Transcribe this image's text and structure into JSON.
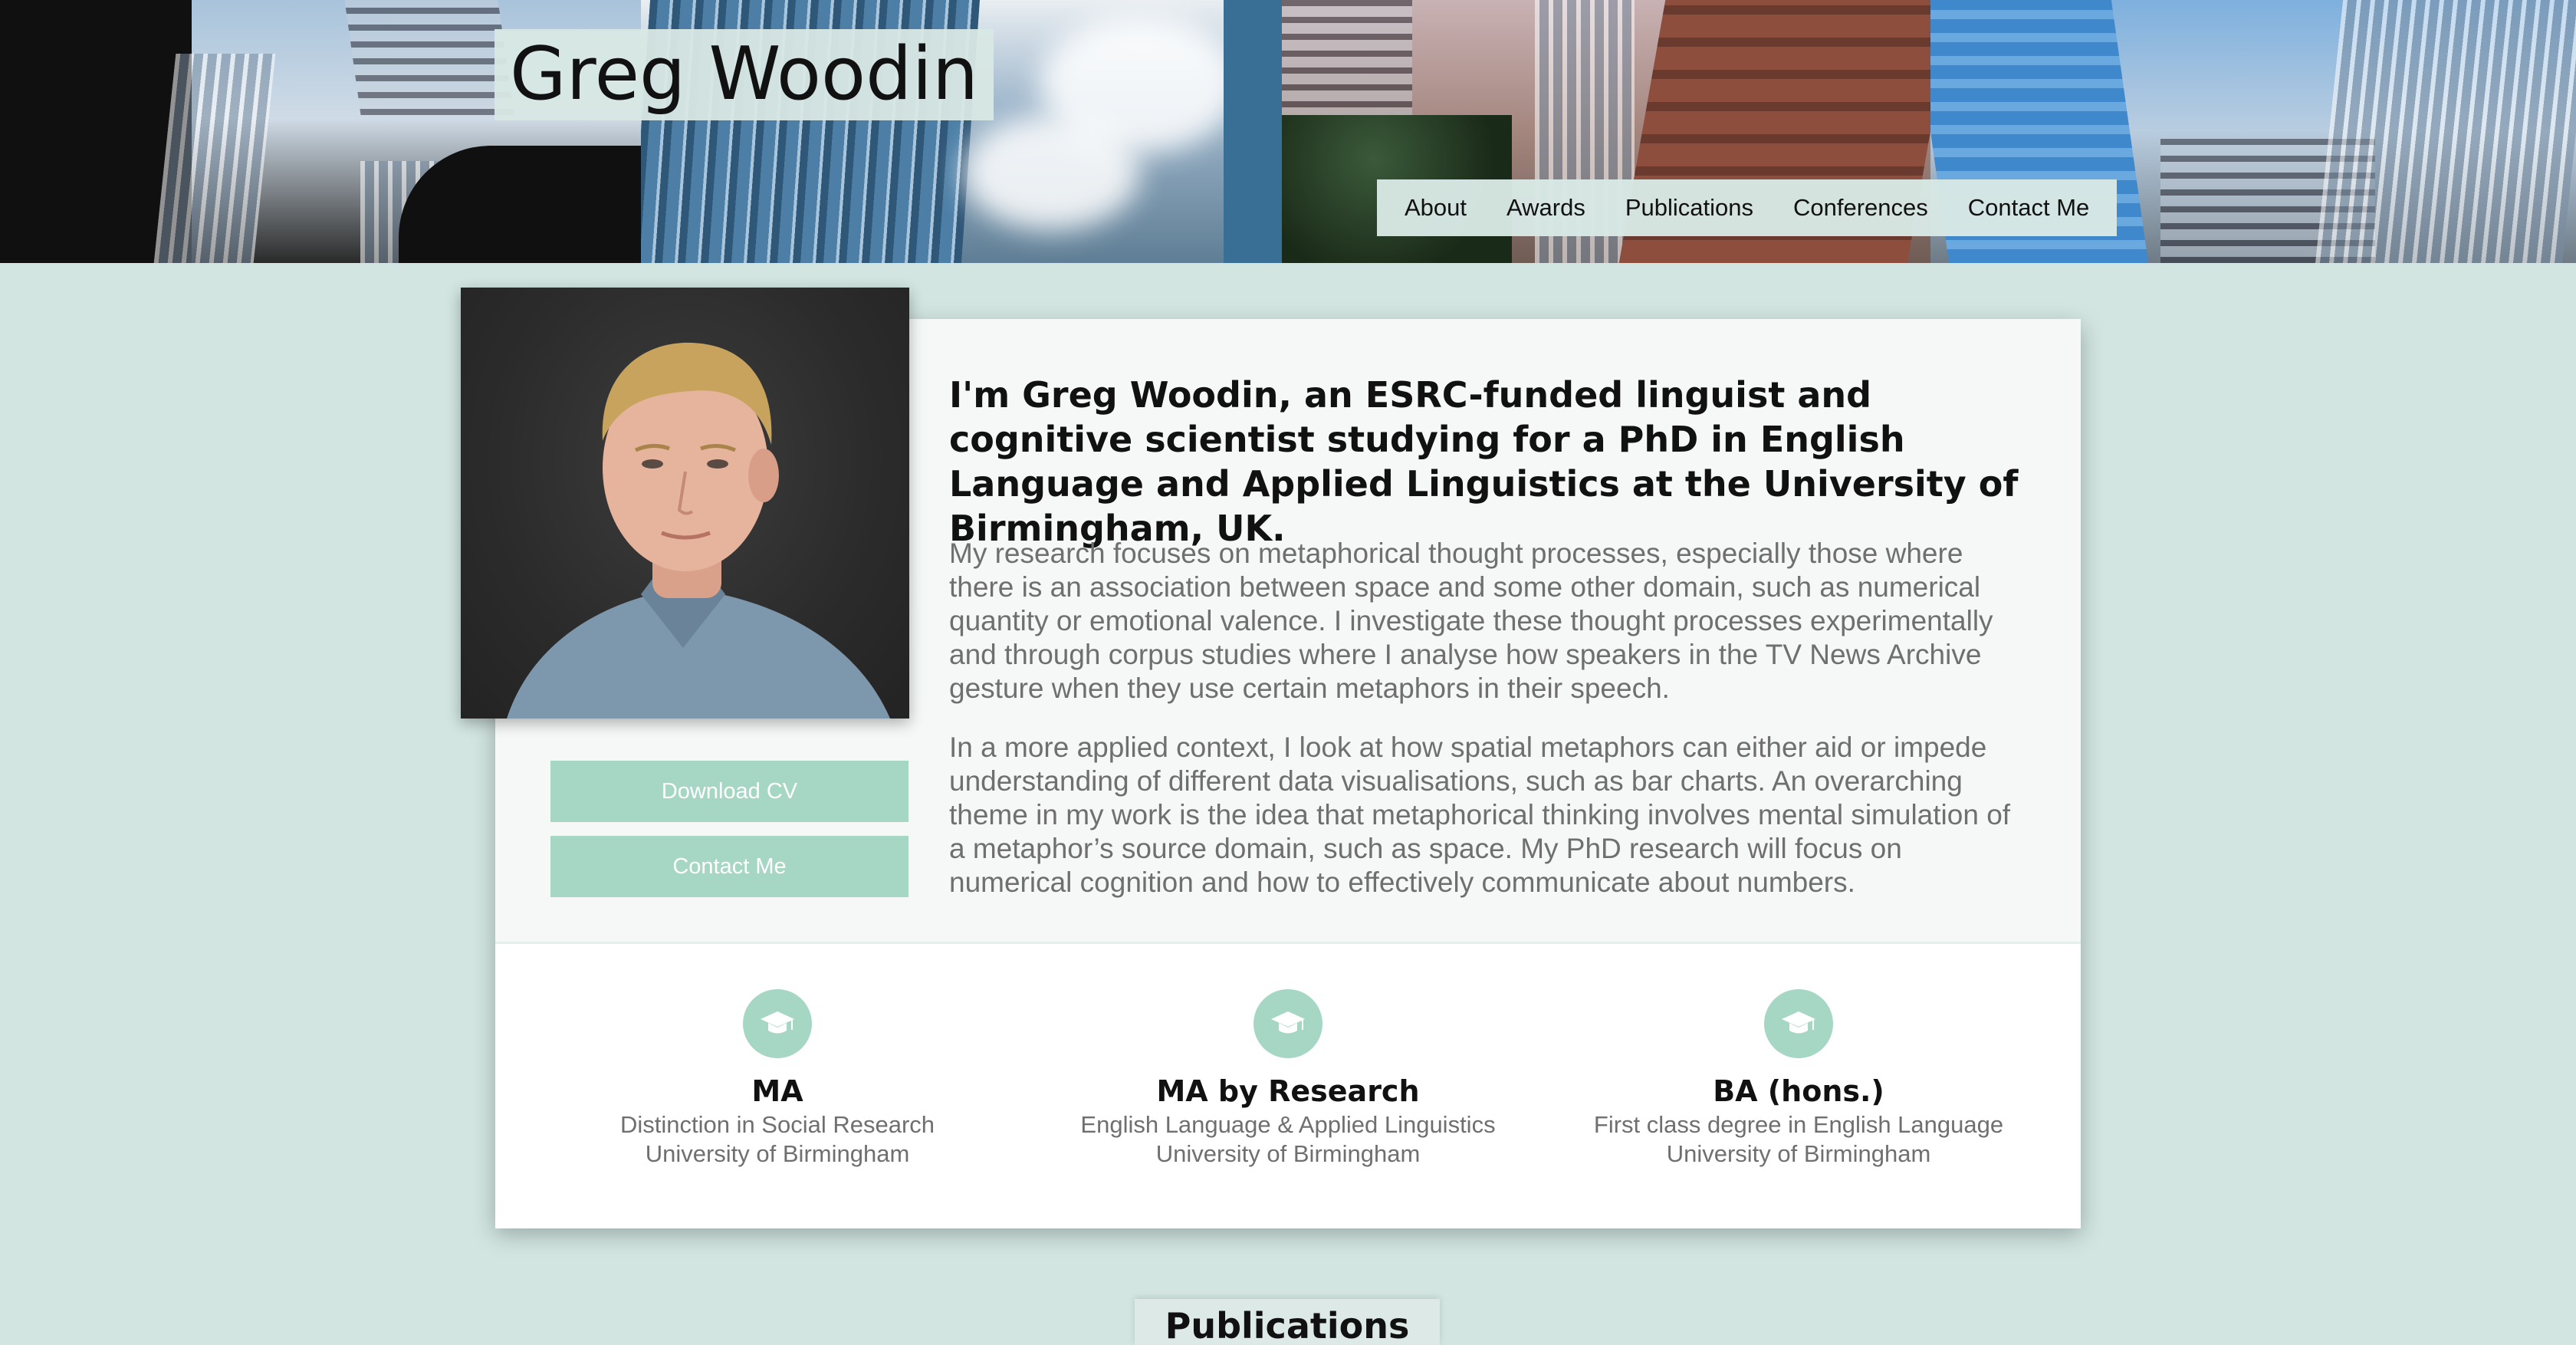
{
  "header": {
    "site_title": "Greg Woodin",
    "nav": [
      "About",
      "Awards",
      "Publications",
      "Conferences",
      "Contact Me"
    ]
  },
  "profile": {
    "buttons": {
      "download_cv": "Download CV",
      "contact_me": "Contact Me"
    }
  },
  "about": {
    "headline": "I'm Greg Woodin, an ESRC-funded linguist and cognitive scientist studying for a PhD in English Language and Applied Linguistics at the University of Birmingham, UK.",
    "paragraphs": [
      "My research focuses on metaphorical thought processes, especially those where there is an association between space and some other domain, such as numerical quantity or emotional valence. I investigate these thought processes experimentally and through corpus studies where I analyse how speakers in the TV News Archive gesture when they use certain metaphors in their speech.",
      "In a more applied context, I look at how spatial metaphors can either aid or impede understanding of different data visualisations, such as bar charts. An overarching theme in my work is the idea that metaphorical thinking involves mental simulation of a metaphor’s source domain, such as space. My PhD research will focus on numerical cognition and how to effectively communicate about numbers."
    ]
  },
  "education": [
    {
      "icon": "graduation-cap-icon",
      "title": "MA",
      "line1": "Distinction in Social Research",
      "line2": "University of Birmingham"
    },
    {
      "icon": "graduation-cap-icon",
      "title": "MA by Research",
      "line1": "English Language & Applied Linguistics",
      "line2": "University of Birmingham"
    },
    {
      "icon": "graduation-cap-icon",
      "title": "BA (hons.)",
      "line1": "First class degree in English Language",
      "line2": "University of Birmingham"
    }
  ],
  "next_section": {
    "title": "Publications"
  },
  "colors": {
    "background": "#d2e5e1",
    "accent": "#a6d6c4",
    "card": "#f5f8f7"
  }
}
